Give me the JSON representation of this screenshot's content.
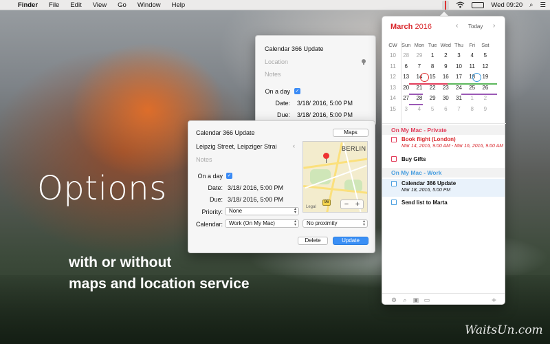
{
  "menubar": {
    "apple": "",
    "items": [
      "Finder",
      "File",
      "Edit",
      "View",
      "Go",
      "Window",
      "Help"
    ],
    "battery": "",
    "clock": "Wed 09:20",
    "search_glyph": "⌕",
    "list_glyph": "☰"
  },
  "overlay": {
    "title": "Options",
    "tagline_1": "with or without",
    "tagline_2": "maps and location service",
    "watermark": "WaitsUn.com"
  },
  "back_popover": {
    "title": "Calendar 366 Update",
    "location_placeholder": "Location",
    "notes_placeholder": "Notes",
    "on_a_day_label": "On a day",
    "date_label": "Date:",
    "date_value": "3/18/ 2016,   5:00 PM",
    "due_label": "Due:",
    "due_value": "3/18/ 2016,   5:00 PM"
  },
  "front_popover": {
    "title": "Calendar 366 Update",
    "maps_button": "Maps",
    "location_value": "Leipzig Street, Leipziger Straße",
    "notes_placeholder": "Notes",
    "on_a_day_label": "On a day",
    "date_label": "Date:",
    "date_value": "3/18/ 2016,   5:00 PM",
    "due_label": "Due:",
    "due_value": "3/18/ 2016,   5:00 PM",
    "priority_label": "Priority:",
    "priority_value": "None",
    "calendar_label": "Calendar:",
    "calendar_value": "Work (On My Mac)",
    "proximity_value": "No proximity",
    "delete_button": "Delete",
    "update_button": "Update",
    "map": {
      "city_label": "BERLIN",
      "legal": "Legal",
      "road_shield": "96",
      "zoom_out": "−",
      "zoom_in": "+"
    }
  },
  "calendar": {
    "month": "March",
    "year": "2016",
    "today_button": "Today",
    "prev": "‹",
    "next": "›",
    "headers": [
      "CW",
      "Sun",
      "Mon",
      "Tue",
      "Wed",
      "Thu",
      "Fri",
      "Sat"
    ],
    "weeks": [
      {
        "cw": "10",
        "days": [
          "28",
          "29",
          "1",
          "2",
          "3",
          "4",
          "5"
        ]
      },
      {
        "cw": "11",
        "days": [
          "6",
          "7",
          "8",
          "9",
          "10",
          "11",
          "12"
        ]
      },
      {
        "cw": "12",
        "days": [
          "13",
          "14",
          "15",
          "16",
          "17",
          "18",
          "19"
        ]
      },
      {
        "cw": "13",
        "days": [
          "20",
          "21",
          "22",
          "23",
          "24",
          "25",
          "26"
        ]
      },
      {
        "cw": "14",
        "days": [
          "27",
          "28",
          "29",
          "30",
          "31",
          "1",
          "2"
        ]
      },
      {
        "cw": "15",
        "days": [
          "3",
          "4",
          "5",
          "6",
          "7",
          "8",
          "9"
        ]
      }
    ]
  },
  "lists": {
    "private_header": "On My Mac - Private",
    "work_header": "On My Mac - Work",
    "tasks": [
      {
        "title": "Book flight (London)",
        "date": "Mar 14, 2016, 9:00 AM - Mar 16, 2016, 9:00 AM"
      },
      {
        "title": "Buy Gifts",
        "date": ""
      },
      {
        "title": "Calendar 366 Update",
        "date": "Mar 18, 2016, 5:00 PM"
      },
      {
        "title": "Send list to Marta",
        "date": ""
      }
    ]
  },
  "toolbar": {
    "plus": "+"
  },
  "colors": {
    "accent_red": "#d8252a",
    "accent_blue": "#3a8ff5",
    "private": "#e23c5a",
    "work": "#4a9fe0"
  }
}
